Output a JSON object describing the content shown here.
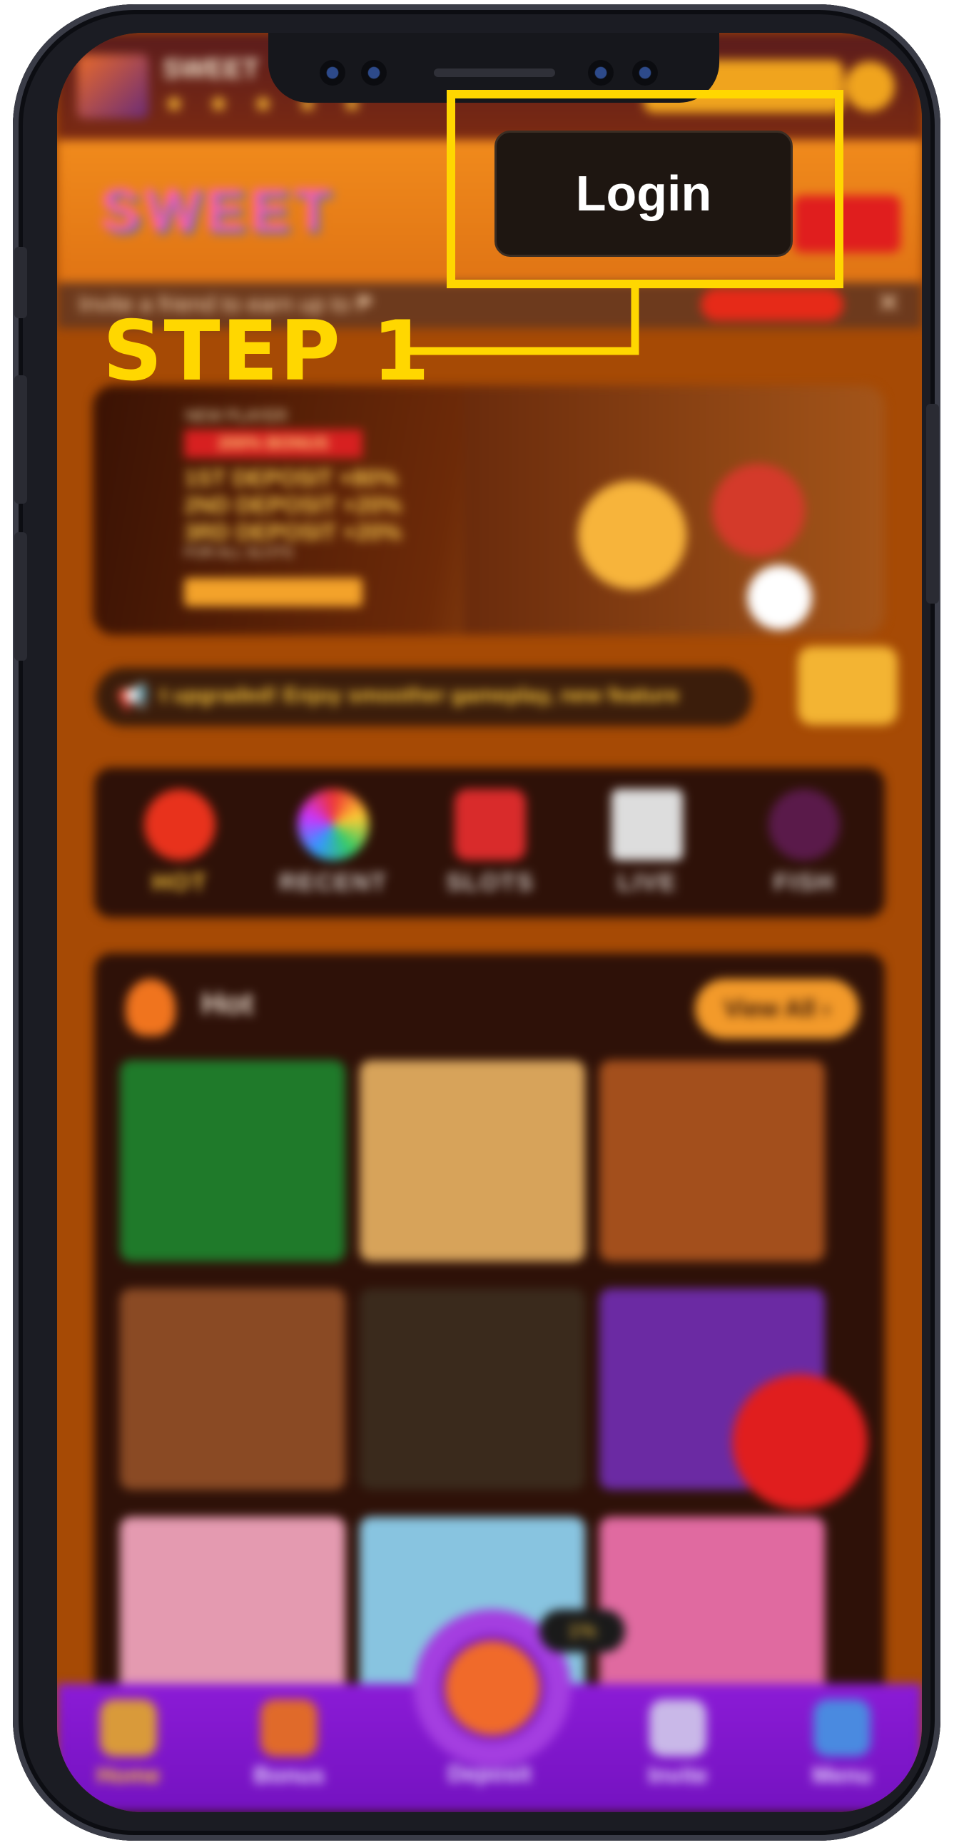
{
  "annotation": {
    "step_label": "STEP 1",
    "highlight_color": "#ffd700"
  },
  "login": {
    "label": "Login"
  },
  "app_banner": {
    "stars": "★ ★ ★ ★ ★",
    "title": "SWEET"
  },
  "invite": {
    "text": "Invite a friend to earn up to ₱",
    "close": "✕"
  },
  "promo": {
    "new_player": "NEW PLAYER",
    "bonus_tag": "200% BONUS",
    "lines": [
      "1ST DEPOSIT +80%",
      "2ND DEPOSIT +20%",
      "3RD DEPOSIT +20%"
    ],
    "all_slots": "FOR ALL SLOTS"
  },
  "marquee": {
    "text": "t upgraded! Enjoy smoother gameplay, new feature"
  },
  "categories": [
    {
      "label": "HOT",
      "color": "#e8321c"
    },
    {
      "label": "RECENT",
      "color": "#e0e0e0"
    },
    {
      "label": "SLOTS",
      "color": "#d92b2b"
    },
    {
      "label": "LIVE",
      "color": "#dddddd"
    },
    {
      "label": "FISH",
      "color": "#5a1a4a"
    }
  ],
  "hot_section": {
    "title": "Hot",
    "view_all": "View All ›"
  },
  "game_tiles": [
    "#1f7a2a",
    "#d7a35a",
    "#a34f1c",
    "#8a4a24",
    "#3a2a1c",
    "#6b2aa3",
    "#e49ab0",
    "#88c4e0",
    "#e06aa0"
  ],
  "deposit_badge": "1%",
  "bottom_nav": [
    {
      "label": "Home",
      "color": "#d99a3a"
    },
    {
      "label": "Bonus",
      "color": "#e06a2a"
    },
    {
      "label": "Deposit",
      "color": "#f06a2a"
    },
    {
      "label": "Invite",
      "color": "#c9b8e8"
    },
    {
      "label": "Menu",
      "color": "#4a8ae0"
    }
  ]
}
